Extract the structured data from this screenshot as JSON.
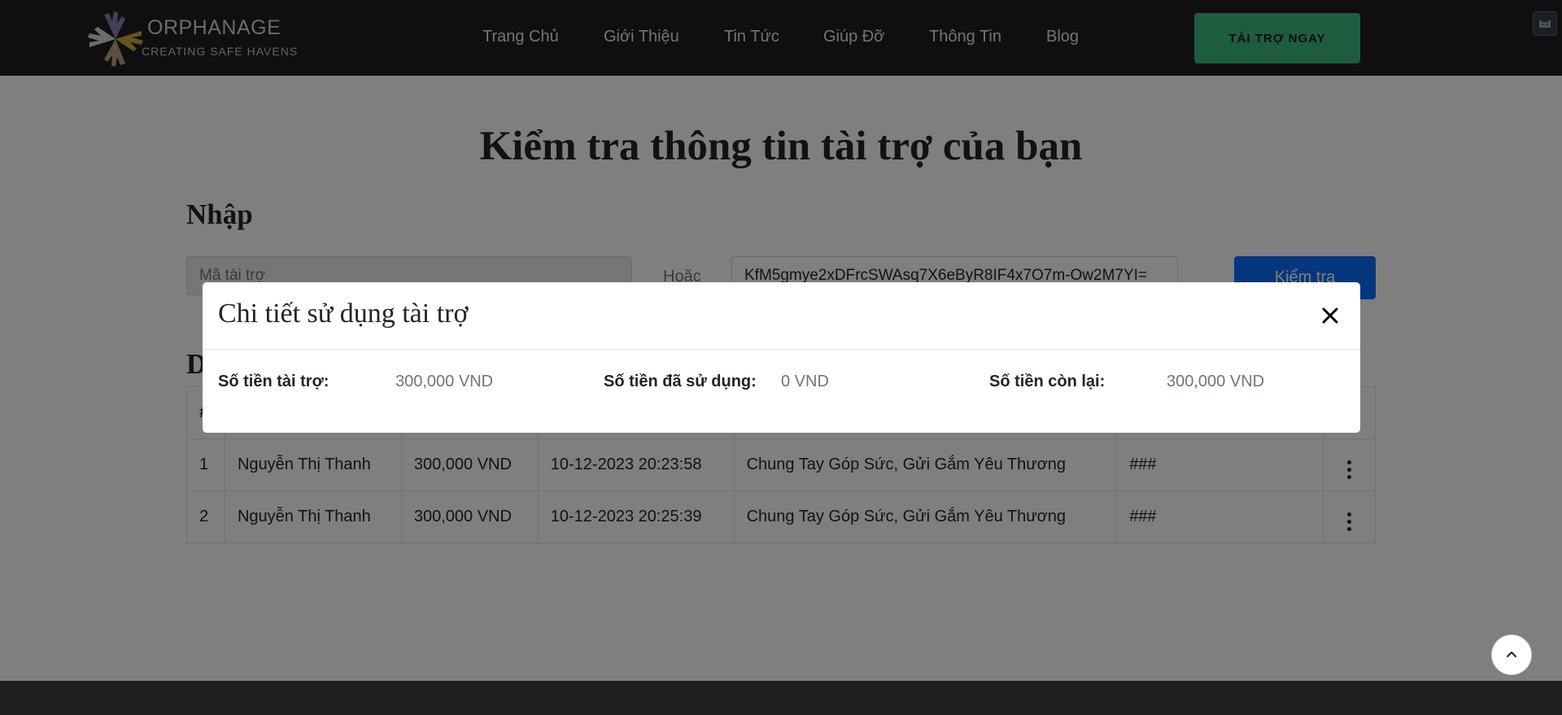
{
  "header": {
    "logo_title": "ORPHANAGE",
    "logo_tagline": "CREATING SAFE HAVENS",
    "nav": [
      {
        "label": "Trang Chủ"
      },
      {
        "label": "Giới Thiệu"
      },
      {
        "label": "Tin Tức"
      },
      {
        "label": "Giúp Đỡ"
      },
      {
        "label": "Thông Tin"
      },
      {
        "label": "Blog"
      }
    ],
    "donate_label": "TÀI TRỢ NGAY"
  },
  "main": {
    "title": "Kiểm tra thông tin tài trợ của bạn",
    "input_heading": "Nhập",
    "code_placeholder": "Mã tài trợ",
    "or_label": "Hoặc",
    "token_value": "KfM5gmye2xDFrcSWAsq7X6eByR8IF4x7O7m-Ow2M7YI=",
    "check_label": "Kiểm tra",
    "list_heading": "D",
    "table": {
      "headers": [
        "#",
        "",
        "",
        "",
        "",
        "",
        ""
      ],
      "rows": [
        {
          "idx": "1",
          "name": "Nguyễn Thị Thanh",
          "amount": "300,000 VND",
          "date": "10-12-2023 20:23:58",
          "campaign": "Chung Tay Góp Sức, Gửi Gắm Yêu Thương",
          "note": "###"
        },
        {
          "idx": "2",
          "name": "Nguyễn Thị Thanh",
          "amount": "300,000 VND",
          "date": "10-12-2023 20:25:39",
          "campaign": "Chung Tay Góp Sức, Gửi Gắm Yêu Thương",
          "note": "###"
        }
      ]
    }
  },
  "modal": {
    "title": "Chi tiết sử dụng tài trợ",
    "donated_label": "Số tiền tài trợ:",
    "donated_value": "300,000 VND",
    "used_label": "Số tiền đã sử dụng:",
    "used_value": "0 VND",
    "remaining_label": "Số tiền còn lại:",
    "remaining_value": "300,000 VND"
  },
  "colors": {
    "header_bg": "#1f1f1f",
    "donate_button": "#3ab87f",
    "check_button": "#0d6efd"
  },
  "icons": {
    "close": "close-icon",
    "kebab": "kebab-menu-icon",
    "scroll_top": "chevron-up-icon"
  }
}
